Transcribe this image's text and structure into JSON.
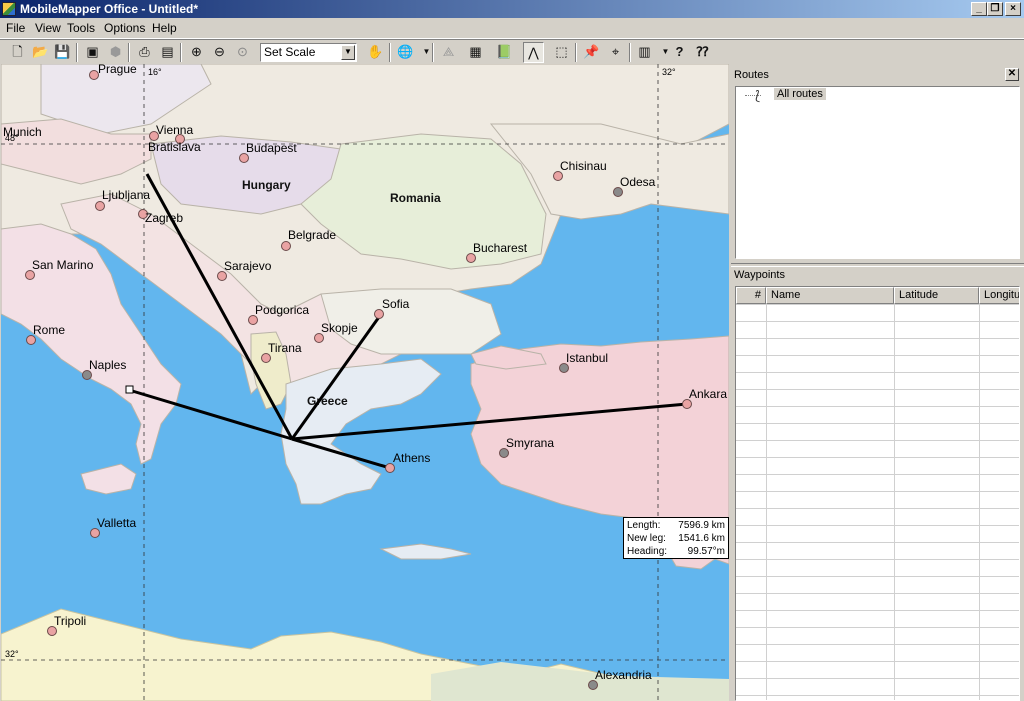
{
  "window": {
    "title": "MobileMapper Office - Untitled*"
  },
  "menu": [
    "File",
    "View",
    "Tools",
    "Options",
    "Help"
  ],
  "toolbar": {
    "scale_select": "Set Scale",
    "icons": [
      "new-file-icon",
      "open-folder-icon",
      "save-icon",
      "import-icon",
      "disabled-icon",
      "print-icon",
      "print-preview-icon",
      "zoom-in-icon",
      "zoom-out-icon",
      "zoom-extent-icon",
      "pan-hand-icon",
      "globe-icon",
      "layers-icon",
      "map-color-icon",
      "book-icon",
      "route-tool-icon",
      "select-rect-icon",
      "pin-icon",
      "measure-icon",
      "device-icon",
      "help-icon",
      "context-help-icon"
    ]
  },
  "map": {
    "grid_labels": [
      "16°",
      "32°",
      "48°",
      "32°"
    ],
    "countries": [
      "Hungary",
      "Romania",
      "Greece"
    ],
    "cities": [
      "Prague",
      "Munich",
      "Vienna",
      "Bratislava",
      "Budapest",
      "Chisinau",
      "Odesa",
      "Ljubljana",
      "Zagreb",
      "Belgrade",
      "Bucharest",
      "San Marino",
      "Sarajevo",
      "Sofia",
      "Podgorica",
      "Skopje",
      "Rome",
      "Tirana",
      "Naples",
      "Istanbul",
      "Ankara",
      "Smyrana",
      "Athens",
      "Valletta",
      "Tripoli",
      "Alexandria"
    ],
    "measure": {
      "length_label": "Length:",
      "length_value": "7596.9 km",
      "newleg_label": "New leg:",
      "newleg_value": "1541.6 km",
      "heading_label": "Heading:",
      "heading_value": "99.57°m"
    }
  },
  "routes_panel": {
    "title": "Routes",
    "root_item": "All routes"
  },
  "waypoints_panel": {
    "title": "Waypoints",
    "columns": [
      "#",
      "Name",
      "Latitude",
      "Longitu"
    ]
  }
}
